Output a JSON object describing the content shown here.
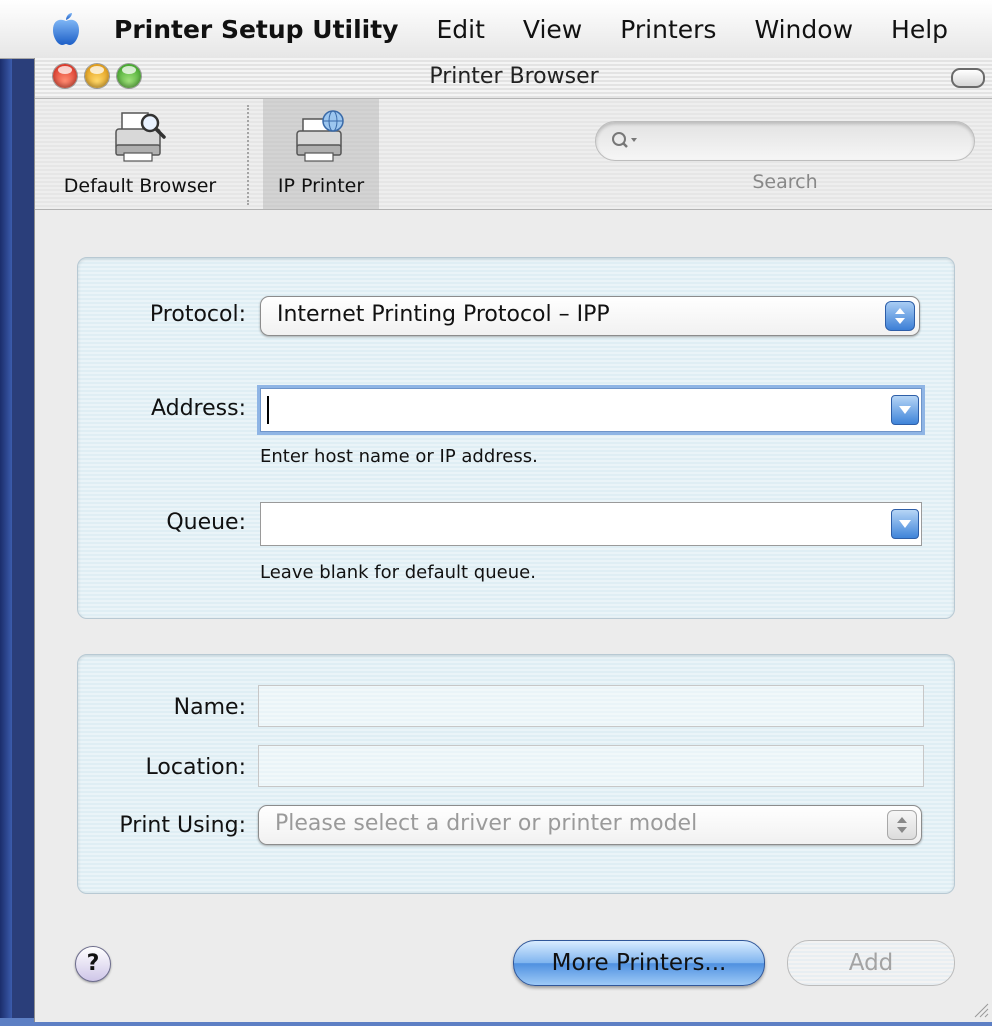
{
  "menubar": {
    "app_name": "Printer Setup Utility",
    "items": [
      "Edit",
      "View",
      "Printers",
      "Window",
      "Help"
    ]
  },
  "window": {
    "title": "Printer Browser"
  },
  "toolbar": {
    "items": [
      {
        "label": "Default Browser",
        "icon": "printer-magnifier-icon",
        "selected": false
      },
      {
        "label": "IP Printer",
        "icon": "network-printer-icon",
        "selected": true
      }
    ],
    "search": {
      "value": "",
      "label": "Search"
    }
  },
  "connection": {
    "protocol_label": "Protocol:",
    "protocol_value": "Internet Printing Protocol – IPP",
    "address_label": "Address:",
    "address_value": "",
    "address_hint": "Enter host name or IP address.",
    "queue_label": "Queue:",
    "queue_value": "",
    "queue_hint": "Leave blank for default queue."
  },
  "details": {
    "name_label": "Name:",
    "name_value": "",
    "location_label": "Location:",
    "location_value": "",
    "print_using_label": "Print Using:",
    "print_using_value": "Please select a driver or printer model"
  },
  "buttons": {
    "help": "?",
    "more_printers": "More Printers...",
    "add": "Add"
  },
  "colors": {
    "primary_button": "#4f90e0",
    "group_background": "#dfeef4",
    "focus_ring": "#8fb5e5"
  }
}
